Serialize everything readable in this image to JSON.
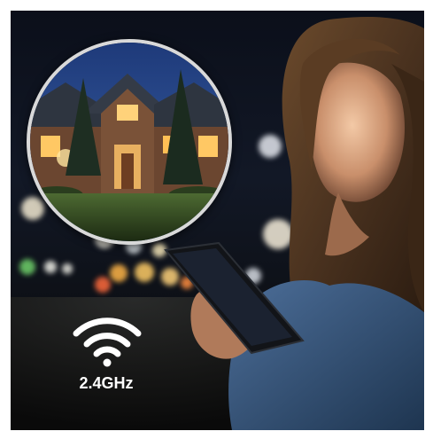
{
  "wifi": {
    "icon": "wifi-icon",
    "frequency_label": "2.4GHz"
  },
  "inset": {
    "subject": "house-at-dusk"
  },
  "colors": {
    "frame_border": "#d9d9d9",
    "label": "#ffffff",
    "sky": "#2a4a86"
  }
}
